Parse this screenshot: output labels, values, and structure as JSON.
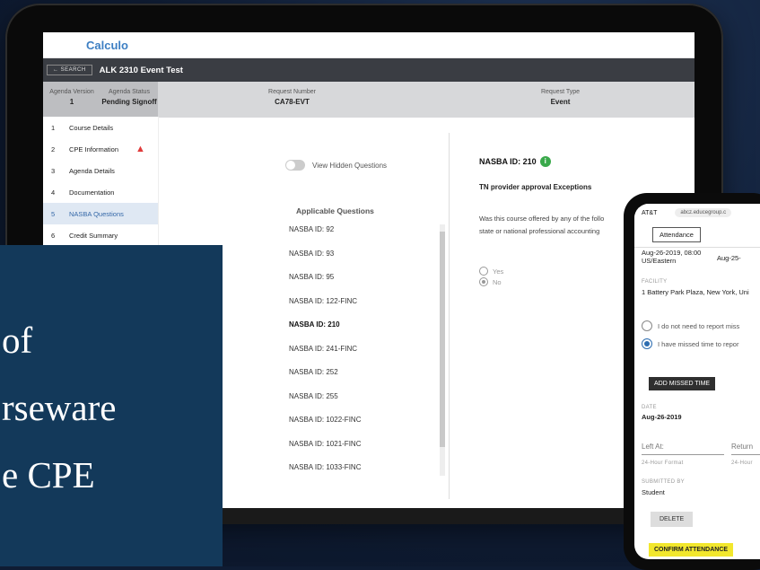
{
  "app": {
    "logo": "Calculo",
    "back_label": "← SEARCH",
    "event_title": "ALK 2310 Event Test"
  },
  "info_bar": {
    "agenda_version_label": "Agenda Version",
    "agenda_version_value": "1",
    "agenda_status_label": "Agenda Status",
    "agenda_status_value": "Pending Signoff",
    "request_number_label": "Request Number",
    "request_number_value": "CA78-EVT",
    "request_type_label": "Request Type",
    "request_type_value": "Event"
  },
  "sidebar": {
    "items": [
      {
        "num": "1",
        "label": "Course Details"
      },
      {
        "num": "2",
        "label": "CPE Information"
      },
      {
        "num": "3",
        "label": "Agenda Details"
      },
      {
        "num": "4",
        "label": "Documentation"
      },
      {
        "num": "5",
        "label": "NASBA Questions"
      },
      {
        "num": "6",
        "label": "Credit Summary"
      }
    ]
  },
  "questions": {
    "toggle_label": "View Hidden Questions",
    "heading": "Applicable Questions",
    "items": [
      "NASBA ID: 92",
      "NASBA ID: 93",
      "NASBA ID: 95",
      "NASBA ID: 122-FINC",
      "NASBA ID: 210",
      "NASBA ID: 241-FINC",
      "NASBA ID: 252",
      "NASBA ID: 255",
      "NASBA ID: 1022-FINC",
      "NASBA ID: 1021-FINC",
      "NASBA ID: 1033-FINC"
    ]
  },
  "detail": {
    "title": "NASBA ID: 210",
    "subtitle": "TN provider approval Exceptions",
    "question_line1": "Was this course offered by any of the follo",
    "question_line2": "state or national professional accounting",
    "option_yes": "Yes",
    "option_no": "No"
  },
  "overlay": {
    "line1": "of",
    "line2": "rseware",
    "line3": "e CPE"
  },
  "phone": {
    "carrier": "AT&T",
    "url": "abcz.educegroup.c",
    "tab_label": "Attendance",
    "date_line1": "Aug-26-2019, 08:00",
    "date_line2": "US/Eastern",
    "date_right": "Aug-25-",
    "facility_label": "FACILITY",
    "facility_value": "1 Battery Park Plaza, New York, Uni",
    "radio_1": "I do not need to report miss",
    "radio_2": "I have missed time to repor",
    "add_button": "ADD MISSED TIME",
    "date_label": "DATE",
    "date_value": "Aug-26-2019",
    "left_at_label": "Left At:",
    "return_label": "Return",
    "format_label": "24-Hour Format",
    "format_label2": "24-Hour",
    "submitted_label": "SUBMITTED BY",
    "submitted_value": "Student",
    "delete_button": "DELETE",
    "confirm_button": "CONFIRM ATTENDANCE"
  }
}
